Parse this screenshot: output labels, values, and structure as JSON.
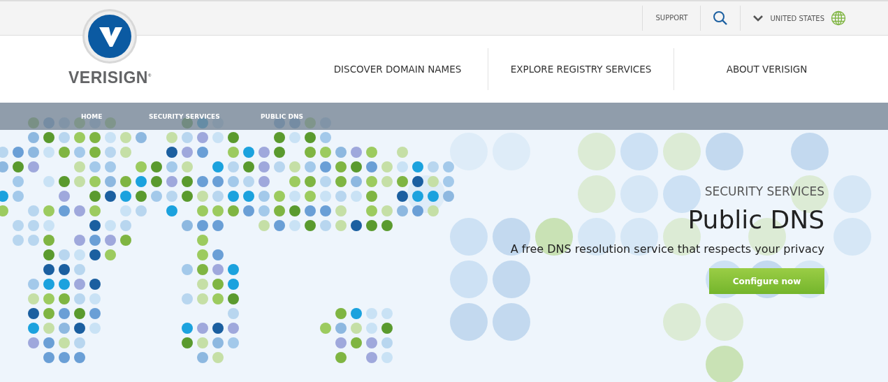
{
  "utility_bar": {
    "links": [
      "SUPPORT"
    ],
    "region": "UNITED STATES"
  },
  "logo": {
    "wordmark": "VERISIGN",
    "mark": "®"
  },
  "nav": [
    "DISCOVER DOMAIN NAMES",
    "EXPLORE REGISTRY SERVICES",
    "ABOUT VERISIGN"
  ],
  "breadcrumb": [
    "HOME",
    "SECURITY SERVICES",
    "PUBLIC DNS"
  ],
  "hero": {
    "eyebrow": "SECURITY SERVICES",
    "title": "Public DNS",
    "subtitle": "A free DNS resolution service that respects your privacy",
    "button": "Configure now"
  }
}
